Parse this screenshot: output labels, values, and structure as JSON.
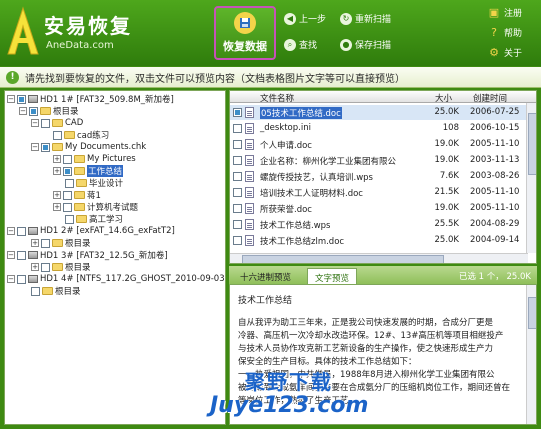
{
  "app": {
    "title": "安易恢复",
    "url": "AneData.com"
  },
  "toolbar": {
    "recover_label": "恢复数据",
    "back_label": "上一步",
    "rescan_label": "重新扫描",
    "find_label": "查找",
    "save_scan_label": "保存扫描"
  },
  "side_menu": {
    "register": "注册",
    "help": "帮助",
    "about": "关于"
  },
  "notice": "请先找到要恢复的文件，双击文件可以预览内容（文档表格图片文字等可以直接预览）",
  "tree": [
    {
      "label": "HD1  1# [FAT32_509.8M_新加卷]"
    },
    {
      "label": "根目录"
    },
    {
      "label": "CAD"
    },
    {
      "label": "cad练习"
    },
    {
      "label": "My Documents.chk"
    },
    {
      "label": "My Pictures"
    },
    {
      "label": "工作总结"
    },
    {
      "label": "毕业设计"
    },
    {
      "label": "蒋1"
    },
    {
      "label": "计算机考试题"
    },
    {
      "label": "高工学习"
    },
    {
      "label": "HD1  2# [exFAT_14.6G_exFatT2]"
    },
    {
      "label": "根目录"
    },
    {
      "label": "HD1  3# [FAT32_12.5G_新加卷]"
    },
    {
      "label": "根目录"
    },
    {
      "label": "HD1  4# [NTFS_117.2G_GHOST_2010-09-03]"
    },
    {
      "label": "根目录"
    }
  ],
  "file_list": {
    "columns": {
      "name": "文件名称",
      "size": "大小",
      "date": "创建时间"
    },
    "rows": [
      {
        "name": "05技术工作总结.doc",
        "size": "25.0K",
        "date": "2006-07-25"
      },
      {
        "name": "_desktop.ini",
        "size": "108",
        "date": "2006-10-15"
      },
      {
        "name": "个人申请.doc",
        "size": "19.0K",
        "date": "2005-11-10"
      },
      {
        "name": "企业名称：柳州化学工业集团有限公",
        "size": "19.0K",
        "date": "2003-11-13"
      },
      {
        "name": "螺旋传授技艺，认真培训.wps",
        "size": "7.6K",
        "date": "2003-08-26"
      },
      {
        "name": "培训技术工人证明材料.doc",
        "size": "21.5K",
        "date": "2005-11-10"
      },
      {
        "name": "所获荣誉.doc",
        "size": "19.0K",
        "date": "2005-11-10"
      },
      {
        "name": "技术工作总结.wps",
        "size": "25.5K",
        "date": "2004-08-29"
      },
      {
        "name": "技术工作总结zlm.doc",
        "size": "25.0K",
        "date": "2004-09-14"
      }
    ]
  },
  "tabs": {
    "hex": "十六进制预览",
    "text": "文字预览"
  },
  "selection_status": "已选 1 个，  25.0K",
  "preview": {
    "heading": "技术工作总结",
    "lines": [
      "自从我评为助工三年来，正是我公司快速发展的时期，合成分厂更是",
      "冷器、高压机一次冷却水改造环保。12#、13#高压机等项目相继投产",
      "与技术人员协作攻克新工艺新设备的生产操作，使之快速形成生产力",
      "保安全的生产目标。具体的技术工作总结如下：",
      "一、热爱祖国，中共党员，1988年8月进入柳州化学工业集团有限公",
      "被分配到合成氨车间，主要在合成氨分厂的压缩机岗位工作，期间还曾在",
      "等岗位工作，熟悉了生产工艺。"
    ]
  },
  "watermark": {
    "line1": "聚野下载",
    "line2": "Juye123.com"
  },
  "colors": {
    "brand_green": "#3e8a12",
    "highlight": "#c653b8",
    "selection": "#316ac5"
  }
}
